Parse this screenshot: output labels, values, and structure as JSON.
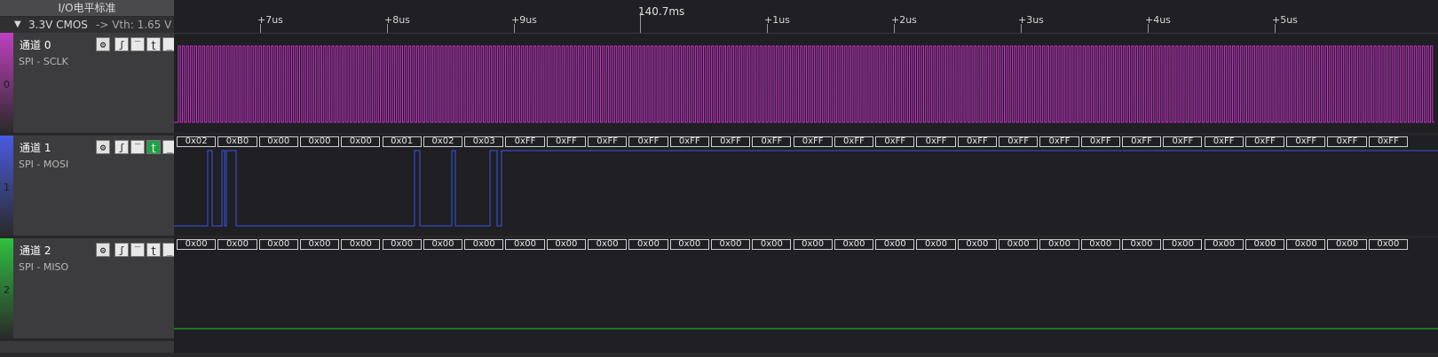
{
  "io_panel": {
    "title": "I/O电平标准",
    "standard": "3.3V CMOS",
    "arrow": "->",
    "vth": "Vth: 1.65 V"
  },
  "ruler": {
    "center_label": "140.7ms",
    "ticks": [
      "+7us",
      "+8us",
      "+9us",
      "+1us",
      "+2us",
      "+3us",
      "+4us",
      "+5us"
    ]
  },
  "channels": [
    {
      "index": "0",
      "name": "通道 0",
      "protocol": "SPI - SCLK",
      "color": "#cc33cc",
      "strip_color": "#c040c0",
      "active_trigger": "none"
    },
    {
      "index": "1",
      "name": "通道 1",
      "protocol": "SPI - MOSI",
      "color": "#3b55e6",
      "strip_color": "#4a5be0",
      "active_trigger": "falling"
    },
    {
      "index": "2",
      "name": "通道 2",
      "protocol": "SPI - MISO",
      "color": "#22cc33",
      "strip_color": "#30c040",
      "active_trigger": "none"
    }
  ],
  "icons": {
    "settings": "gear-icon",
    "rising": "rising-edge-icon",
    "high": "high-level-icon",
    "falling": "falling-edge-icon",
    "low": "low-level-icon"
  },
  "mosi_bytes": [
    "0x02",
    "0xB0",
    "0x00",
    "0x00",
    "0x00",
    "0x01",
    "0x02",
    "0x03",
    "0xFF",
    "0xFF",
    "0xFF",
    "0xFF",
    "0xFF",
    "0xFF",
    "0xFF",
    "0xFF",
    "0xFF",
    "0xFF",
    "0xFF",
    "0xFF",
    "0xFF",
    "0xFF",
    "0xFF",
    "0xFF",
    "0xFF",
    "0xFF",
    "0xFF",
    "0xFF",
    "0xFF",
    "0xFF"
  ],
  "miso_bytes": [
    "0x00",
    "0x00",
    "0x00",
    "0x00",
    "0x00",
    "0x00",
    "0x00",
    "0x00",
    "0x00",
    "0x00",
    "0x00",
    "0x00",
    "0x00",
    "0x00",
    "0x00",
    "0x00",
    "0x00",
    "0x00",
    "0x00",
    "0x00",
    "0x00",
    "0x00",
    "0x00",
    "0x00",
    "0x00",
    "0x00",
    "0x00",
    "0x00",
    "0x00",
    "0x00"
  ]
}
